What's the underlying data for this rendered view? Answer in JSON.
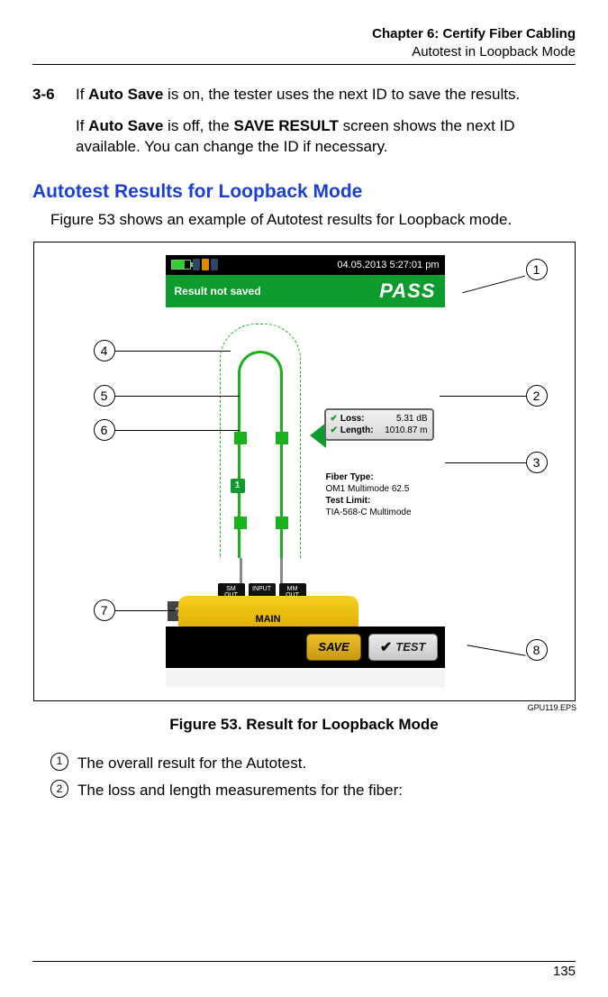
{
  "header": {
    "chapter": "Chapter 6: Certify Fiber Cabling",
    "section": "Autotest in Loopback Mode"
  },
  "step": {
    "number": "3-6",
    "para1_pre": "If ",
    "para1_b1": "Auto Save",
    "para1_mid": " is on, the tester uses the next ID to save the results.",
    "para2_pre": "If ",
    "para2_b1": "Auto Save",
    "para2_mid": " is off, the ",
    "para2_b2": "SAVE RESULT",
    "para2_end": " screen shows the next ID available. You can change the ID if necessary."
  },
  "section_title": "Autotest Results for Loopback Mode",
  "intro": "Figure 53 shows an example of Autotest results for Loopback mode.",
  "screen": {
    "datetime": "04.05.2013 5:27:01 pm",
    "banner_left": "Result not saved",
    "banner_right": "PASS",
    "loss_label": "Loss:",
    "loss_value": "5.31 dB",
    "length_label": "Length:",
    "length_value": "1010.87 m",
    "fiber_type_label": "Fiber Type:",
    "fiber_type_value": "OM1 Multimode 62.5",
    "test_limit_label": "Test Limit:",
    "test_limit_value": "TIA-568-C Multimode",
    "module_label": "MAIN",
    "port1": "SM OUT",
    "port2": "INPUT",
    "port3": "MM OUT",
    "diagram_badge": "1",
    "help": "?",
    "save_btn": "SAVE",
    "test_btn": "TEST"
  },
  "callouts": {
    "c1": "1",
    "c2": "2",
    "c3": "3",
    "c4": "4",
    "c5": "5",
    "c6": "6",
    "c7": "7",
    "c8": "8"
  },
  "eps": "GPU119.EPS",
  "caption": "Figure 53. Result for Loopback Mode",
  "legend": {
    "n1": "1",
    "t1": "The overall result for the Autotest.",
    "n2": "2",
    "t2": "The loss and length measurements for the fiber:"
  },
  "page_number": "135"
}
